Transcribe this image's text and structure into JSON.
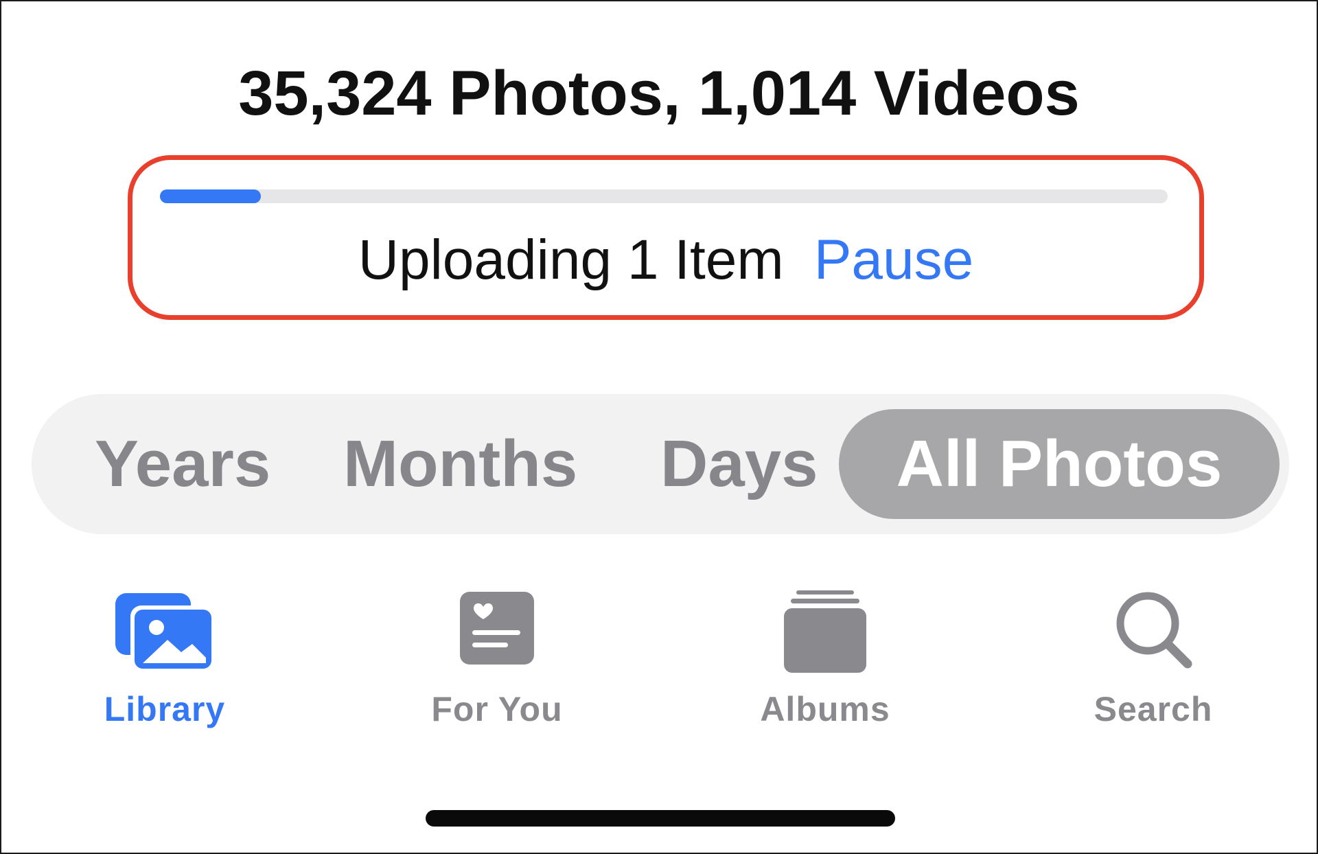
{
  "library_summary": {
    "counts_text": "35,324 Photos, 1,014 Videos"
  },
  "upload": {
    "progress": 0.1,
    "status_text": "Uploading 1 Item",
    "pause_label": "Pause"
  },
  "view_segments": {
    "items": [
      {
        "label": "Years",
        "selected": false
      },
      {
        "label": "Months",
        "selected": false
      },
      {
        "label": "Days",
        "selected": false
      },
      {
        "label": "All Photos",
        "selected": true
      }
    ]
  },
  "tab_bar": {
    "items": [
      {
        "label": "Library",
        "icon": "photo-library-icon",
        "active": true
      },
      {
        "label": "For You",
        "icon": "for-you-heart-card-icon",
        "active": false
      },
      {
        "label": "Albums",
        "icon": "albums-stack-icon",
        "active": false
      },
      {
        "label": "Search",
        "icon": "search-icon",
        "active": false
      }
    ]
  },
  "colors": {
    "accent": "#3478f6",
    "highlight_box": "#e8402c",
    "inactive": "#8a8a8e",
    "segment_selected_bg": "#a7a7a9"
  }
}
